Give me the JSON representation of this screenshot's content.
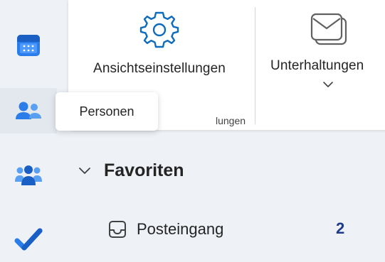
{
  "rail": {
    "items": [
      {
        "name": "calendar",
        "icon": "calendar-icon",
        "active": false
      },
      {
        "name": "people",
        "icon": "people-icon",
        "active": true
      },
      {
        "name": "groups",
        "icon": "groups-icon",
        "active": false
      },
      {
        "name": "todo",
        "icon": "checkmark-icon",
        "active": false
      }
    ],
    "tooltip": "Personen"
  },
  "ribbon": {
    "view_settings_label": "Ansichtseinstellungen",
    "conversations_label": "Unterhaltungen",
    "group_label_partial": "lungen"
  },
  "folders": {
    "section_title": "Favoriten",
    "items": [
      {
        "label": "Posteingang",
        "count": "2",
        "icon": "inbox-icon"
      }
    ]
  },
  "colors": {
    "accent": "#0f6cbd",
    "rail_background": "#eef1f6",
    "count": "#1f3a8a"
  }
}
